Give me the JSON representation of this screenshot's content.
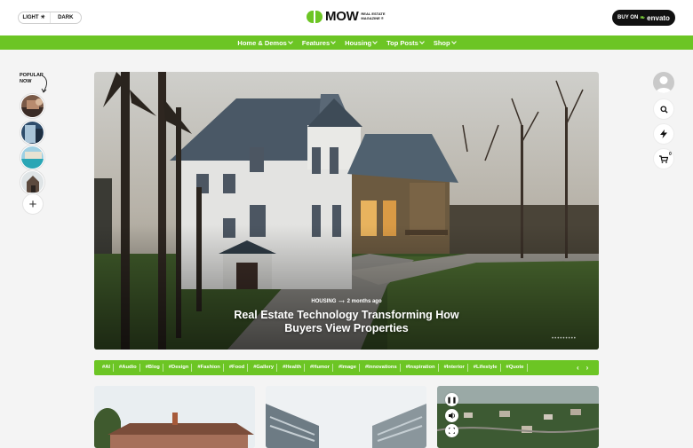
{
  "header": {
    "mode_light": "LIGHT",
    "mode_dark": "DARK",
    "logo_name": "MOW",
    "logo_sub": "REAL ESTATE MAGAZINE ®",
    "buy_prefix": "BUY ON",
    "buy_brand": "envato"
  },
  "nav": {
    "items": [
      "Home & Demos",
      "Features",
      "Housing",
      "Top Posts",
      "Shop"
    ]
  },
  "popular": {
    "label_line1": "POPULAR",
    "label_line2": "NOW",
    "add": "+"
  },
  "right_rail": {
    "icons": [
      "avatar",
      "search-icon",
      "bolt-icon",
      "cart-icon"
    ],
    "cart_count": "0"
  },
  "hero": {
    "category": "HOUSING",
    "date": "2 months ago",
    "title_line1": "Real Estate Technology Transforming How",
    "title_line2": "Buyers View Properties"
  },
  "tags": [
    "#AI",
    "#Audio",
    "#Blog",
    "#Design",
    "#Fashion",
    "#Food",
    "#Gallery",
    "#Health",
    "#Humor",
    "#Image",
    "#Innovations",
    "#Inspiration",
    "#Interior",
    "#Lifestyle",
    "#Quote"
  ],
  "tag_nav": {
    "prev": "‹",
    "next": "›"
  },
  "colors": {
    "accent": "#6cc524",
    "dark": "#111111"
  }
}
